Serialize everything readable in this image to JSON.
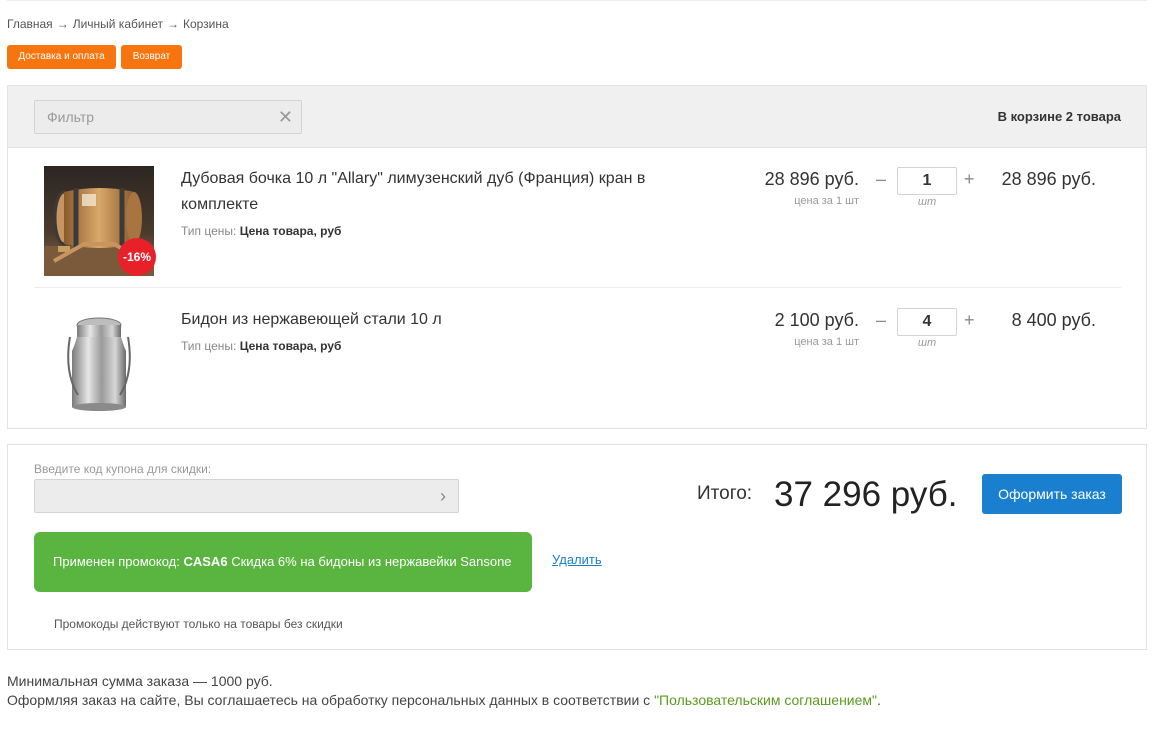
{
  "breadcrumb": [
    "Главная",
    "Личный кабинет",
    "Корзина"
  ],
  "breadcrumb_sep": "→",
  "top_buttons": {
    "delivery": "Доставка и оплата",
    "returns": "Возврат"
  },
  "filter": {
    "placeholder": "Фильтр",
    "clear_icon": "close-icon"
  },
  "cart_count_text": "В корзине 2 товара",
  "price_type_label": "Тип цены:",
  "items": [
    {
      "name": "Дубовая бочка 10 л \"Allary\" лимузенский дуб (Франция) кран в комплекте",
      "price_type": "Цена товара, руб",
      "price": "28 896 руб.",
      "price_note": "цена за 1 шт",
      "quantity": "1",
      "unit": "шт",
      "total": "28 896 руб.",
      "discount_badge": "-16%",
      "image": "oak-barrel-image"
    },
    {
      "name": "Бидон из нержавеющей стали 10 л",
      "price_type": "Цена товара, руб",
      "price": "2 100 руб.",
      "price_note": "цена за 1 шт",
      "quantity": "4",
      "unit": "шт",
      "total": "8 400 руб.",
      "image": "milk-can-image"
    }
  ],
  "qty_controls": {
    "minus": "–",
    "plus": "+"
  },
  "coupon": {
    "label": "Введите код купона для скидки:",
    "value": "",
    "arrow_icon": "chevron-right-icon"
  },
  "promo": {
    "prefix": "Применен промокод:",
    "code": "CASA6",
    "description": "Скидка 6% на бидоны из нержавейки Sansone",
    "remove": "Удалить",
    "note": "Промокоды действуют только на товары без скидки"
  },
  "summary": {
    "label": "Итого:",
    "value": "37 296 руб.",
    "checkout": "Оформить заказ"
  },
  "footer": {
    "min_order": "Минимальная сумма заказа — 1000 руб.",
    "agree_prefix": "Оформляя заказ на сайте, Вы соглашаетесь на обработку персональных данных в соответствии с ",
    "agree_link": "\"Пользовательским соглашением\"",
    "agree_suffix": "."
  },
  "colors": {
    "orange": "#f7750f",
    "green": "#59b53f",
    "blue": "#1b7fd0",
    "badge_red": "#e8202a",
    "link_green": "#5a9b1f"
  }
}
